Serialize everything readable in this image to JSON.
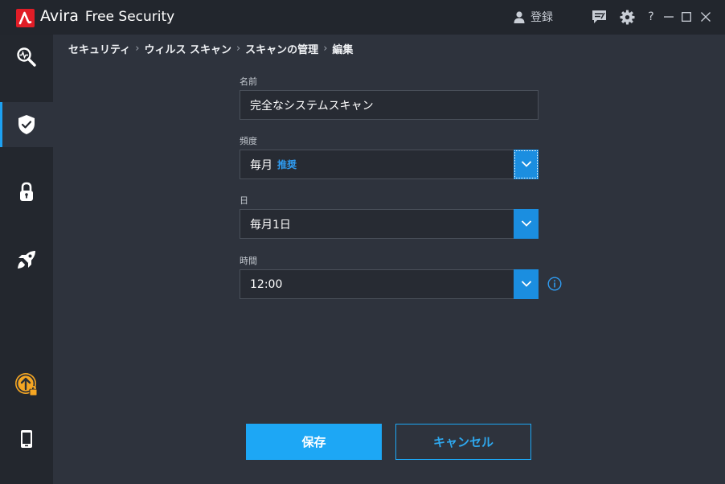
{
  "titlebar": {
    "brand": "Avira",
    "product": "Free Security",
    "register_label": "登録",
    "icons": [
      "feedback-icon",
      "gear-icon",
      "help-icon",
      "minimize-icon",
      "maximize-icon",
      "close-icon"
    ],
    "help_glyph": "?"
  },
  "sidebar": {
    "items": [
      {
        "name": "status",
        "icon": "pulse-magnifier-icon"
      },
      {
        "name": "security",
        "icon": "shield-check-icon",
        "active": true
      },
      {
        "name": "privacy",
        "icon": "lock-icon"
      },
      {
        "name": "performance",
        "icon": "rocket-icon"
      },
      {
        "name": "upgrade",
        "icon": "upgrade-arrow-icon"
      },
      {
        "name": "mobile",
        "icon": "mobile-phone-icon"
      }
    ]
  },
  "breadcrumb": {
    "items": [
      "セキュリティ",
      "ウィルス スキャン",
      "スキャンの管理",
      "編集"
    ],
    "separator": "›"
  },
  "form": {
    "name_label": "名前",
    "name_value": "完全なシステムスキャン",
    "frequency_label": "頻度",
    "frequency_value": "毎月",
    "frequency_tag": "推奨",
    "day_label": "日",
    "day_value": "毎月1日",
    "time_label": "時間",
    "time_value": "12:00"
  },
  "actions": {
    "save_label": "保存",
    "cancel_label": "キャンセル"
  },
  "colors": {
    "accent": "#1da7f5",
    "brand_red": "#e11d27",
    "background": "#2e333d",
    "sidebar": "#23272e"
  }
}
